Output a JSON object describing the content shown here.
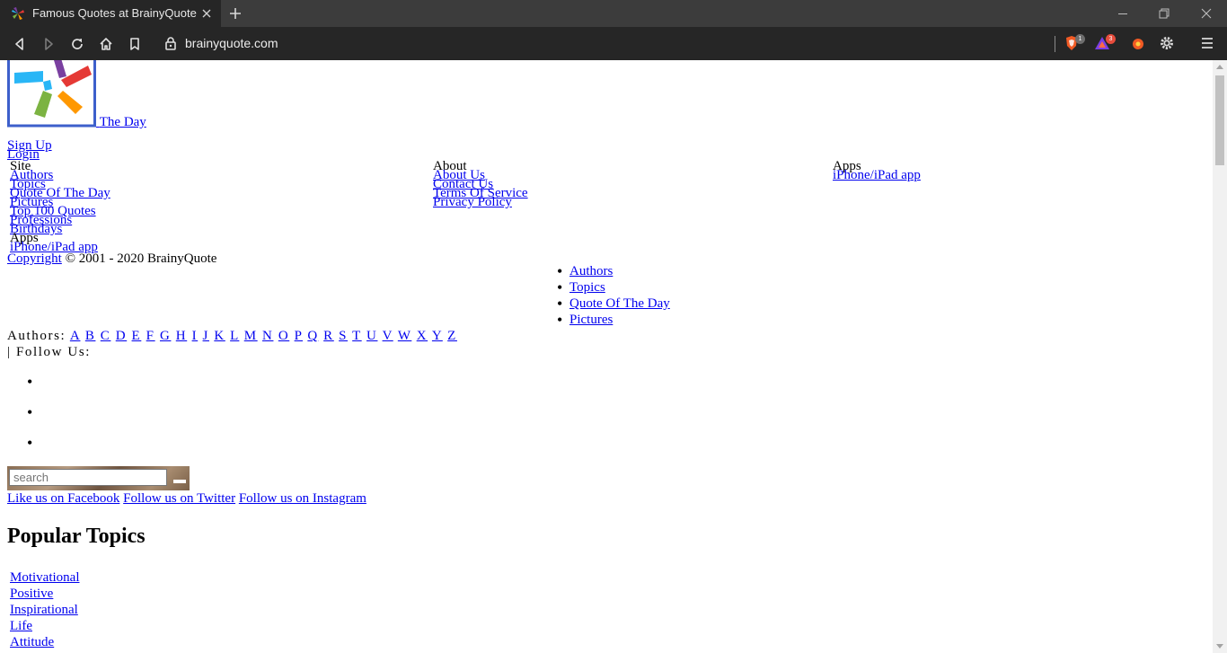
{
  "browser": {
    "tab_title": "Famous Quotes at BrainyQuote",
    "url": "brainyquote.com",
    "shields_badge": "1",
    "rewards_badge": "3"
  },
  "header": {
    "qotd_link": "The Day",
    "signup": "Sign Up",
    "login": "Login"
  },
  "footer_nav": {
    "site_heading": "Site",
    "site_links": [
      "Authors",
      "Topics",
      "Quote Of The Day",
      "Pictures",
      "Top 100 Quotes",
      "Professions",
      "Birthdays"
    ],
    "apps_heading_left": "Apps",
    "app_link_left": "iPhone/iPad app",
    "about_heading": "About",
    "about_links": [
      "About Us",
      "Contact Us",
      "Terms Of Service",
      "Privacy Policy"
    ],
    "apps_heading": "Apps",
    "app_link": "iPhone/iPad app",
    "copyright_link": "Copyright",
    "copyright_text": "© 2001 - 2020 BrainyQuote"
  },
  "main_nav": [
    "Authors",
    "Topics",
    "Quote Of The Day",
    "Pictures"
  ],
  "authors_bar": {
    "label": "Authors:",
    "letters": [
      "A",
      "B",
      "C",
      "D",
      "E",
      "F",
      "G",
      "H",
      "I",
      "J",
      "K",
      "L",
      "M",
      "N",
      "O",
      "P",
      "Q",
      "R",
      "S",
      "T",
      "U",
      "V",
      "W",
      "X",
      "Y",
      "Z"
    ],
    "follow_label": "| Follow Us:"
  },
  "search": {
    "placeholder": "search"
  },
  "social": {
    "facebook": "Like us on Facebook",
    "twitter": "Follow us on Twitter",
    "instagram": "Follow us on Instagram"
  },
  "popular": {
    "heading": "Popular Topics",
    "topics": [
      "Motivational",
      "Positive",
      "Inspirational",
      "Life",
      "Attitude"
    ]
  },
  "colors": {
    "link": "#0000ee",
    "chrome_dark": "#262626",
    "tabbar": "#3c3c3c"
  }
}
